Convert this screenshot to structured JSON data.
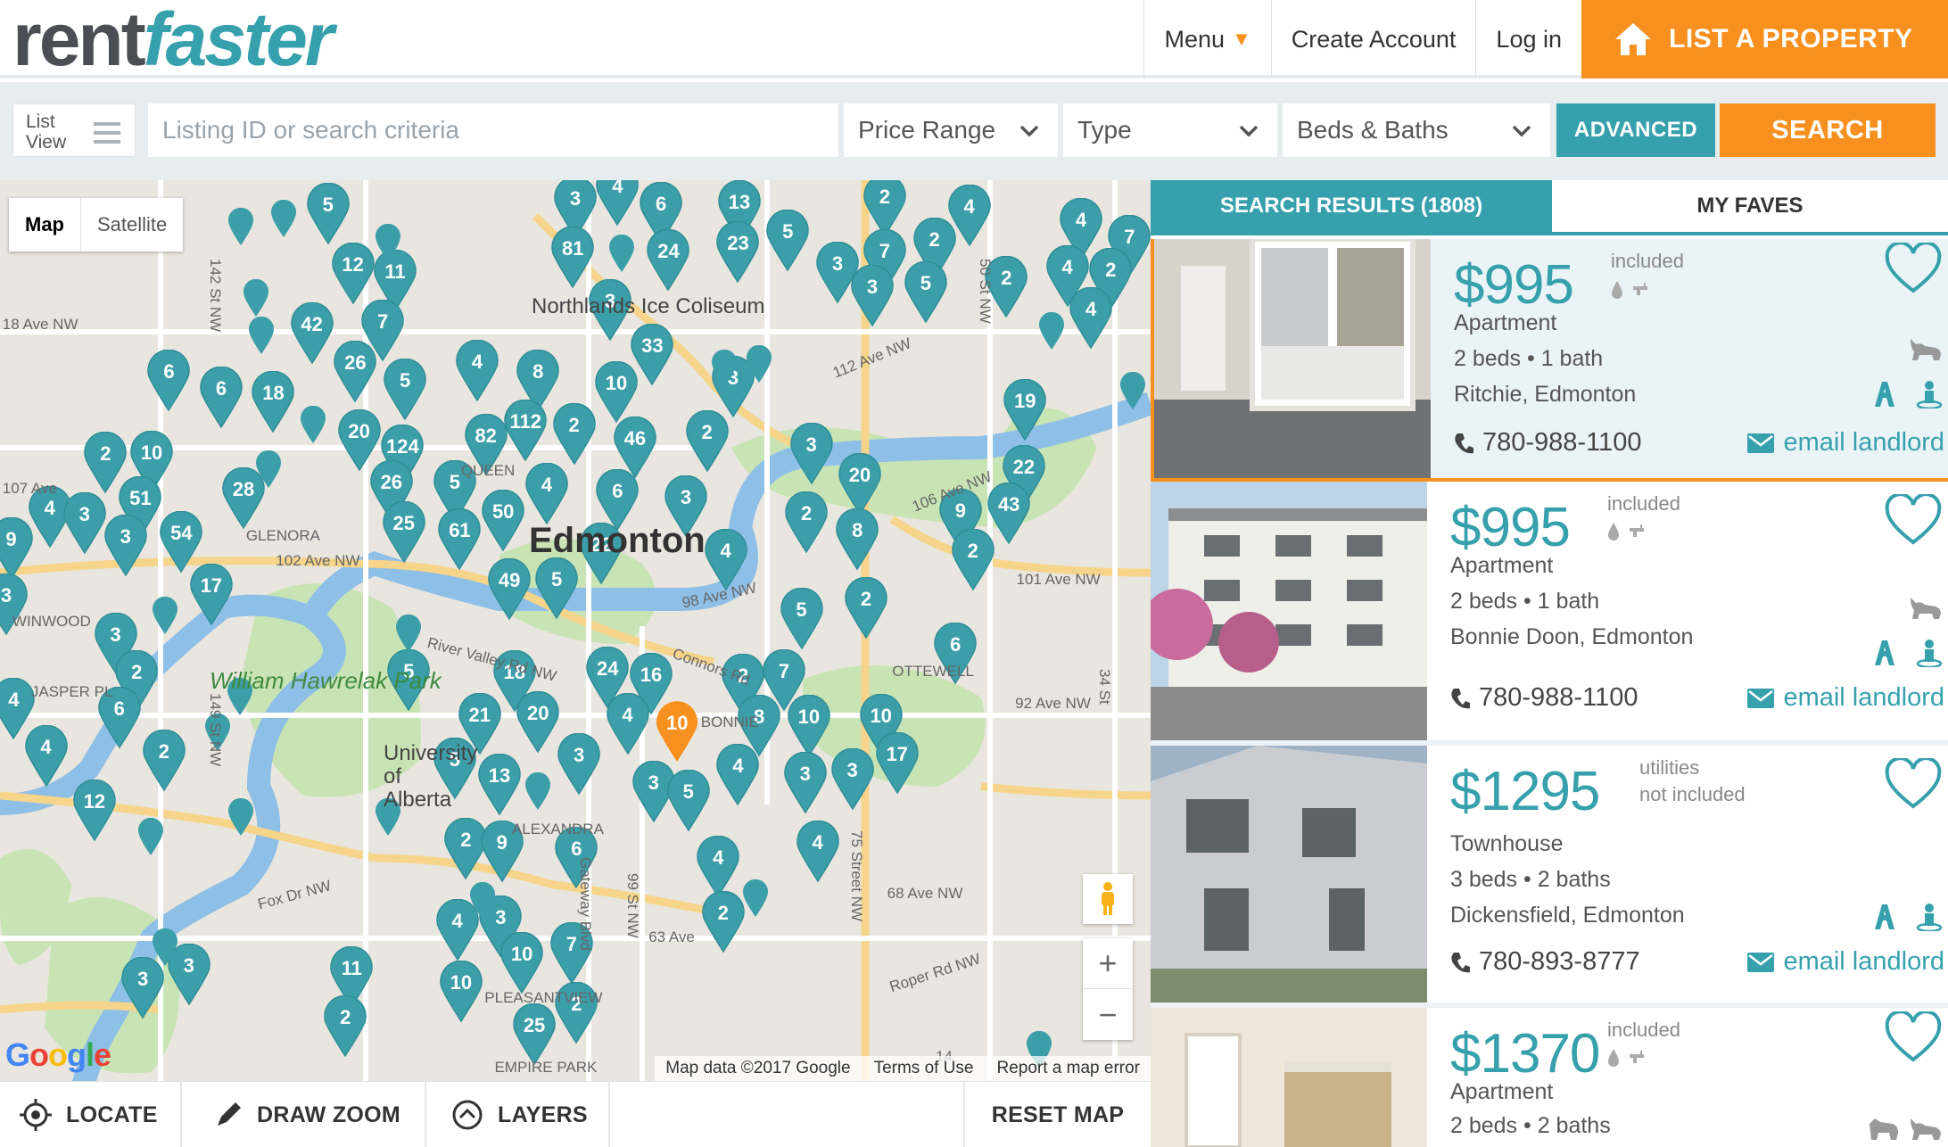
{
  "header": {
    "logo_part1": "rent",
    "logo_part2": "faster",
    "menu_label": "Menu",
    "create_account": "Create Account",
    "login": "Log in",
    "list_property": "LIST A PROPERTY"
  },
  "search": {
    "list_view_label": "List View",
    "placeholder": "Listing ID or search criteria",
    "price_range": "Price Range",
    "type": "Type",
    "beds_baths": "Beds & Baths",
    "advanced": "ADVANCED",
    "search_button": "SEARCH"
  },
  "map": {
    "map_tab": "Map",
    "satellite_tab": "Satellite",
    "city_label": "Edmonton",
    "arena_label": "Northlands Ice Coliseum",
    "park_label": "William Hawrelak Park",
    "university_label": "University of Alberta",
    "attribution": "Map data ©2017 Google",
    "terms": "Terms of Use",
    "report": "Report a map error",
    "google": "Google",
    "clusters": [
      "3",
      "4",
      "6",
      "13",
      "2",
      "5",
      "4",
      "4",
      "7",
      "12",
      "11",
      "81",
      "24",
      "23",
      "5",
      "3",
      "7",
      "2",
      "3",
      "5",
      "2",
      "4",
      "2",
      "4",
      "3",
      "42",
      "7",
      "6",
      "6",
      "18",
      "26",
      "5",
      "4",
      "8",
      "10",
      "33",
      "3",
      "19",
      "2",
      "10",
      "20",
      "124",
      "82",
      "112",
      "2",
      "46",
      "2",
      "3",
      "20",
      "22",
      "4",
      "3",
      "51",
      "54",
      "28",
      "26",
      "5",
      "4",
      "6",
      "3",
      "9",
      "43",
      "3",
      "25",
      "61",
      "50",
      "22",
      "2",
      "8",
      "9",
      "4",
      "2",
      "17",
      "49",
      "5",
      "5",
      "2",
      "3",
      "3",
      "2",
      "18",
      "24",
      "16",
      "2",
      "7",
      "6",
      "5",
      "4",
      "20",
      "21",
      "10",
      "8",
      "10",
      "4",
      "6",
      "4",
      "2",
      "12",
      "5",
      "13",
      "3",
      "3",
      "5",
      "4",
      "3",
      "3",
      "17",
      "2",
      "9",
      "6",
      "4",
      "4",
      "3",
      "4",
      "2",
      "10",
      "7",
      "3",
      "11",
      "3",
      "10",
      "2",
      "2",
      "25",
      "2"
    ],
    "highlight_cluster": "10",
    "street_labels": [
      "18 Ave NW",
      "107 Ave",
      "102 Ave NW",
      "112 Ave NW",
      "106 Ave NW",
      "101 Ave NW",
      "98 Ave NW",
      "92 Ave NW",
      "68 Ave NW",
      "63 Ave",
      "Fox Dr NW",
      "Roper Rd NW",
      "Gateway Blvd",
      "99 St NW",
      "50 St NW",
      "34 St",
      "149 St NW",
      "142 St NW",
      "Connors Rd",
      "River Valley Rd NW",
      "GLENORA",
      "ALEXANDRA",
      "JASPER PL",
      "WINWOOD",
      "OTTEWELL",
      "BONNIE",
      "EMPIRE PARK",
      "PLEASANTVIEW",
      "QUEEN",
      "75 Street NW",
      "14"
    ],
    "locate": "LOCATE",
    "draw_zoom": "DRAW ZOOM",
    "layers": "LAYERS",
    "reset": "RESET MAP"
  },
  "results": {
    "tab_results": "SEARCH RESULTS (1808)",
    "tab_faves": "MY FAVES",
    "listings": [
      {
        "price": "$995",
        "utilities": "included",
        "type": "Apartment",
        "beds": "2 beds • 1 bath",
        "location": "Ritchie, Edmonton",
        "phone": "780-988-1100",
        "email": "email landlord"
      },
      {
        "price": "$995",
        "utilities": "included",
        "type": "Apartment",
        "beds": "2 beds • 1 bath",
        "location": "Bonnie Doon, Edmonton",
        "phone": "780-988-1100",
        "email": "email landlord"
      },
      {
        "price": "$1295",
        "utilities_line1": "utilities",
        "utilities_line2": "not included",
        "type": "Townhouse",
        "beds": "3 beds • 2 baths",
        "location": "Dickensfield, Edmonton",
        "phone": "780-893-8777",
        "email": "email landlord"
      },
      {
        "price": "$1370",
        "utilities": "included",
        "type": "Apartment",
        "beds": "2 beds • 2 baths"
      }
    ]
  },
  "colors": {
    "teal": "#36a0ad",
    "orange": "#f7901e",
    "highlight_pin": "#f7901e"
  }
}
